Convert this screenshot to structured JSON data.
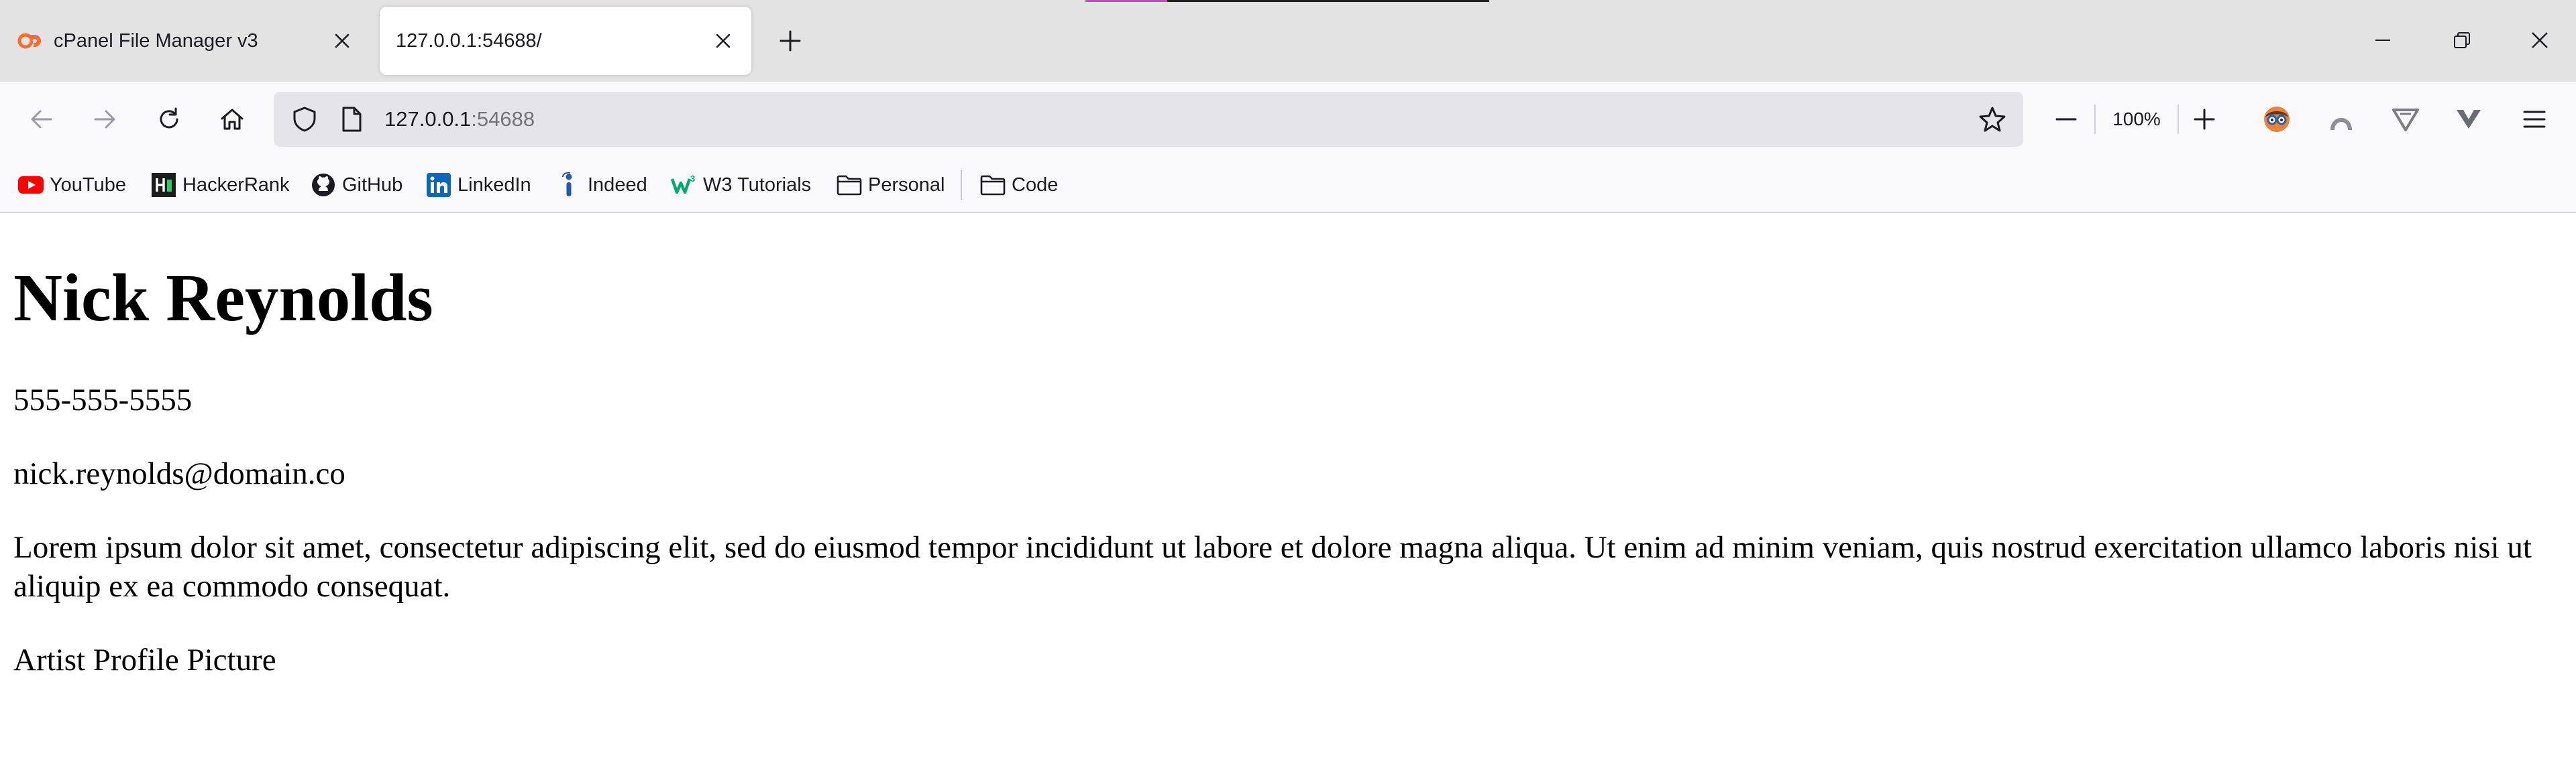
{
  "tabs": [
    {
      "title": "cPanel File Manager v3",
      "active": false,
      "favicon": "cpanel-icon"
    },
    {
      "title": "127.0.0.1:54688/",
      "active": true,
      "favicon": "none"
    }
  ],
  "navigation": {
    "url_host": "127.0.0.1",
    "url_port": ":54688",
    "zoom_level": "100%"
  },
  "bookmarks": [
    {
      "label": "YouTube",
      "icon": "youtube-icon"
    },
    {
      "label": "HackerRank",
      "icon": "hackerrank-icon"
    },
    {
      "label": "GitHub",
      "icon": "github-icon"
    },
    {
      "label": "LinkedIn",
      "icon": "linkedin-icon"
    },
    {
      "label": "Indeed",
      "icon": "indeed-icon"
    },
    {
      "label": "W3 Tutorials",
      "icon": "w3-icon"
    },
    {
      "label": "Personal",
      "icon": "folder-icon"
    },
    {
      "label": "Code",
      "icon": "folder-icon"
    }
  ],
  "page": {
    "name": "Nick Reynolds",
    "phone": "555-555-5555",
    "email": "nick.reynolds@domain.co",
    "bio": "Lorem ipsum dolor sit amet, consectetur adipiscing elit, sed do eiusmod tempor incididunt ut labore et dolore magna aliqua. Ut enim ad minim veniam, quis nostrud exercitation ullamco laboris nisi ut aliquip ex ea commodo consequat.",
    "image_alt": "Artist Profile Picture"
  },
  "colors": {
    "tabstrip": "#e4e3e3",
    "toolbar": "#f9f9fb",
    "urlbar": "#e5e5e9",
    "accent_pink": "#d63fd0",
    "cpanel_orange": "#ff6c2c"
  }
}
